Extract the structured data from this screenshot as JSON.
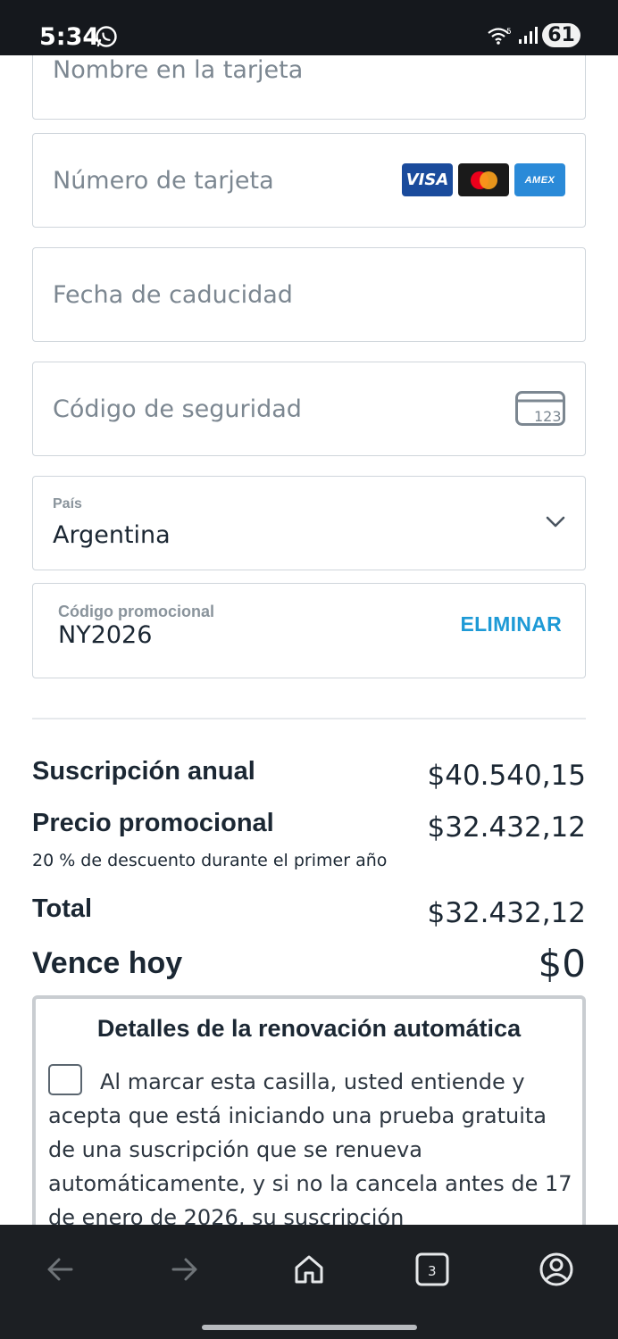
{
  "status_bar": {
    "time": "5:34",
    "battery": "61",
    "icons": [
      "whatsapp-icon",
      "wifi-icon",
      "signal-icon",
      "battery-icon"
    ]
  },
  "form": {
    "cardholder_placeholder": "Nombre en la tarjeta",
    "card_number_placeholder": "Número de tarjeta",
    "card_logos": {
      "visa": "VISA",
      "amex": "AMEX",
      "mastercard": "mastercard-logo"
    },
    "expiry_placeholder": "Fecha de caducidad",
    "security_code_placeholder": "Código de seguridad",
    "cvc_icon_text": "123",
    "country_label": "País",
    "country_value": "Argentina",
    "promo_label": "Código promocional",
    "promo_value": "NY2026",
    "promo_remove": "ELIMINAR"
  },
  "summary": {
    "annual_label": "Suscripción anual",
    "annual_value": "$40.540,15",
    "promo_price_label": "Precio promocional",
    "promo_price_value": "$32.432,12",
    "promo_note": "20 % de descuento durante el primer año",
    "total_label": "Total",
    "total_value": "$32.432,12",
    "due_today_label": "Vence hoy",
    "due_today_value": "$0"
  },
  "renewal": {
    "title": "Detalles de la renovación automática",
    "checkbox_checked": false,
    "text": "Al marcar esta casilla, usted entiende y acepta que está iniciando una prueba gratuita de una suscripción que se renueva automáticamente, y si no la cancela antes de 17 de enero de 2026, su suscripción"
  },
  "bottom_nav": {
    "tab_count": "3",
    "icons": [
      "back-arrow-icon",
      "forward-arrow-icon",
      "home-icon",
      "tabs-icon",
      "account-icon"
    ]
  },
  "colors": {
    "accent": "#1e9ad6",
    "text": "#1b2733",
    "border": "#cfd5db",
    "system_bar": "#15181d"
  }
}
